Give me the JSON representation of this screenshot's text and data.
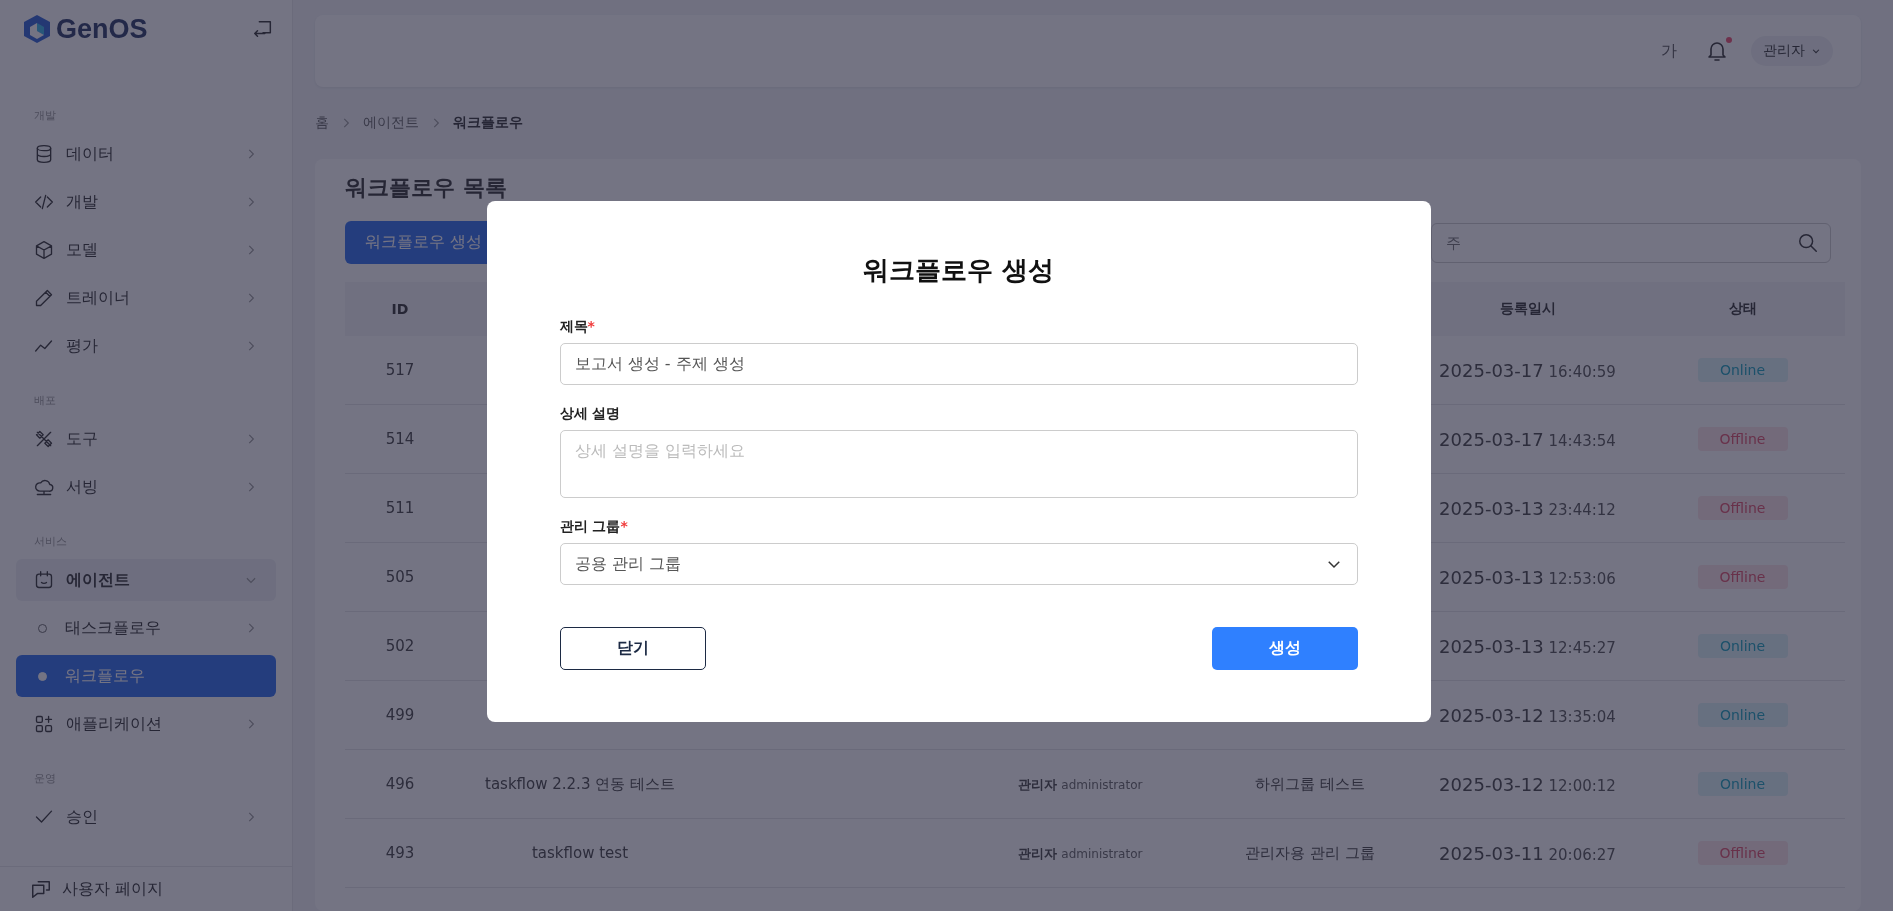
{
  "sidebar": {
    "logo": "GenOS",
    "sections": [
      {
        "title": "개발",
        "items": [
          {
            "label": "데이터",
            "kind": "branch",
            "expanded": false,
            "selected": false
          },
          {
            "label": "개발",
            "kind": "branch",
            "expanded": false,
            "selected": false
          },
          {
            "label": "모델",
            "kind": "branch",
            "expanded": false,
            "selected": false
          },
          {
            "label": "트레이너",
            "kind": "branch",
            "expanded": false,
            "selected": false
          },
          {
            "label": "평가",
            "kind": "branch",
            "expanded": false,
            "selected": false
          }
        ]
      },
      {
        "title": "배포",
        "items": [
          {
            "label": "도구",
            "kind": "branch",
            "expanded": false,
            "selected": false
          },
          {
            "label": "서빙",
            "kind": "branch",
            "expanded": false,
            "selected": false
          }
        ]
      },
      {
        "title": "서비스",
        "items": [
          {
            "label": "에이전트",
            "kind": "branch",
            "expanded": true,
            "selected": false,
            "children": [
              {
                "label": "태스크플로우",
                "kind": "branch",
                "expanded": false,
                "selected": false
              },
              {
                "label": "워크플로우",
                "kind": "leaf",
                "selected": true
              }
            ]
          },
          {
            "label": "애플리케이션",
            "kind": "branch",
            "expanded": false,
            "selected": false
          }
        ]
      },
      {
        "title": "운영",
        "items": [
          {
            "label": "승인",
            "kind": "branch",
            "expanded": false,
            "selected": false
          }
        ]
      }
    ],
    "footer": "사용자 페이지"
  },
  "header": {
    "font_button": "가",
    "notifications_unread": true,
    "user": "관리자"
  },
  "breadcrumb": [
    {
      "label": "홈",
      "current": false
    },
    {
      "label": "에이전트",
      "current": false
    },
    {
      "label": "워크플로우",
      "current": true
    }
  ],
  "page": {
    "title": "워크플로우 목록",
    "create_button": "워크플로우 생성",
    "search": {
      "placeholder": "주"
    }
  },
  "table": {
    "columns": [
      "ID",
      "",
      "",
      "",
      "",
      "등록일시",
      "상태"
    ],
    "rows": [
      {
        "id": "517",
        "date": "2025-03-17",
        "time": "16:40:59",
        "status": {
          "label": "Online",
          "kind": "online"
        }
      },
      {
        "id": "514",
        "date": "2025-03-17",
        "time": "14:43:54",
        "status": {
          "label": "Offline",
          "kind": "offline"
        }
      },
      {
        "id": "511",
        "date": "2025-03-13",
        "time": "23:44:12",
        "status": {
          "label": "Offline",
          "kind": "offline"
        }
      },
      {
        "id": "505",
        "date": "2025-03-13",
        "time": "12:53:06",
        "status": {
          "label": "Offline",
          "kind": "offline"
        }
      },
      {
        "id": "502",
        "date": "2025-03-13",
        "time": "12:45:27",
        "status": {
          "label": "Online",
          "kind": "online"
        }
      },
      {
        "id": "499",
        "date": "2025-03-12",
        "time": "13:35:04",
        "status": {
          "label": "Online",
          "kind": "online"
        }
      },
      {
        "id": "496",
        "name": "taskflow 2.2.3 연동 테스트",
        "owner": "관리자",
        "owner_role": "administrator",
        "group": "하위그룹 테스트",
        "date": "2025-03-12",
        "time": "12:00:12",
        "status": {
          "label": "Online",
          "kind": "online"
        }
      },
      {
        "id": "493",
        "name": "taskflow test",
        "owner": "관리자",
        "owner_role": "administrator",
        "group": "관리자용 관리 그룹",
        "date": "2025-03-11",
        "time": "20:06:27",
        "status": {
          "label": "Offline",
          "kind": "offline"
        }
      }
    ]
  },
  "modal": {
    "title": "워크플로우 생성",
    "required_mark": "*",
    "fields": [
      {
        "label": "제목",
        "required": true,
        "kind": "input",
        "value": "보고서 생성 - 주제 생성"
      },
      {
        "label": "상세 설명",
        "required": false,
        "kind": "textarea",
        "placeholder": "상세 설명을 입력하세요"
      },
      {
        "label": "관리 그룹",
        "required": true,
        "kind": "select",
        "value": "공용 관리 그룹"
      }
    ],
    "buttons": [
      {
        "label": "닫기",
        "kind": "secondary"
      },
      {
        "label": "생성",
        "kind": "primary"
      }
    ]
  }
}
